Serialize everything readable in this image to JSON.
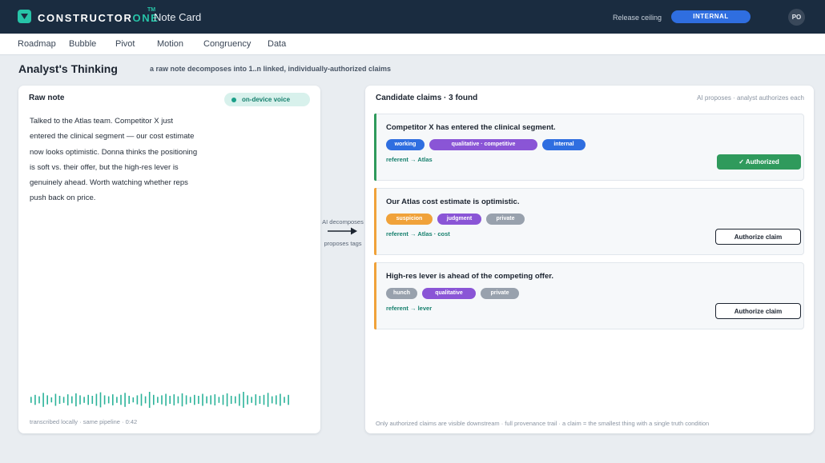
{
  "header": {
    "brand_prefix": "CONSTRUCTOR",
    "brand_suffix": "ONE",
    "trademark": "TM",
    "app_title": "Note Card",
    "release_label": "Release ceiling",
    "release_value": "INTERNAL",
    "avatar_initials": "PO",
    "logo_icon": "chevron-down-icon"
  },
  "nav": {
    "items": [
      "Roadmap",
      "Bubble",
      "Pivot",
      "Motion",
      "Congruency",
      "Data"
    ]
  },
  "page": {
    "title": "Analyst's Thinking",
    "subtitle": "a raw note decomposes into 1..n linked, individually-authorized claims"
  },
  "raw_note": {
    "title": "Raw note",
    "voice_badge": "on-device voice",
    "text": "Talked to the Atlas team. Competitor X just entered the clinical segment — our cost estimate now looks optimistic. Donna thinks the positioning is soft vs. their offer, but the high-res lever is genuinely ahead. Worth watching whether reps push back on price.",
    "footer": "transcribed locally · same pipeline · 0:42"
  },
  "decompose": {
    "top_label": "AI decomposes",
    "bottom_label": "proposes tags",
    "icon": "arrow-right-icon"
  },
  "claims_panel": {
    "title": "Candidate claims · 3 found",
    "hint": "AI proposes · analyst authorizes each",
    "footer": "Only authorized claims are visible downstream · full provenance trail · a claim = the smallest thing with a single truth condition",
    "claims": [
      {
        "text": "Competitor X has entered the clinical segment.",
        "accent": "#2f9a5c",
        "tags": [
          {
            "label": "working",
            "color": "#2f6ee0"
          },
          {
            "label": "qualitative · competitive",
            "color": "#8a55d6"
          },
          {
            "label": "internal",
            "color": "#2f6ee0"
          }
        ],
        "referent": "referent → Atlas",
        "action": "✓ Authorized",
        "authorized": true
      },
      {
        "text": "Our Atlas cost estimate is optimistic.",
        "accent": "#f0a23a",
        "tags": [
          {
            "label": "suspicion",
            "color": "#f0a23a"
          },
          {
            "label": "judgment",
            "color": "#8a55d6"
          },
          {
            "label": "private",
            "color": "#98a1ad"
          }
        ],
        "referent": "referent → Atlas · cost",
        "action": "Authorize claim",
        "authorized": false
      },
      {
        "text": "High-res lever is ahead of the competing offer.",
        "accent": "#f0a23a",
        "tags": [
          {
            "label": "hunch",
            "color": "#98a1ad"
          },
          {
            "label": "qualitative",
            "color": "#8a55d6"
          },
          {
            "label": "private",
            "color": "#98a1ad"
          }
        ],
        "referent": "referent → lever",
        "action": "Authorize claim",
        "authorized": false
      }
    ]
  }
}
